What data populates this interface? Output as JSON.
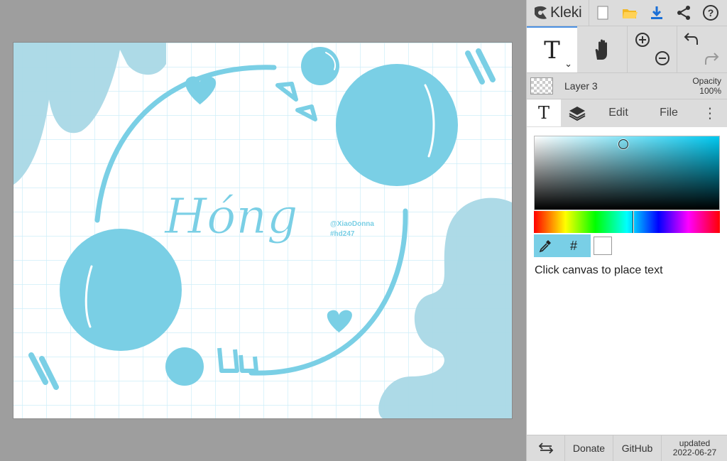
{
  "app": {
    "name": "Kleki"
  },
  "colors": {
    "accent": "#4a90e2",
    "art_blue": "#7acfe5",
    "art_blue_light": "#a9d8e6",
    "grid": "#cdeef9",
    "selected_color": "#00c8f0"
  },
  "canvas": {
    "art_title": "Hóng",
    "handle": "@XiaoDonna",
    "tag": "#hd247"
  },
  "toolbar": {
    "icons": [
      "new-file-icon",
      "open-folder-icon",
      "download-icon",
      "share-icon",
      "help-icon"
    ],
    "help_glyph": "?"
  },
  "tools": {
    "text_tool_glyph": "T",
    "dropdown_glyph": "⌄"
  },
  "layer": {
    "name": "Layer 3",
    "opacity_label": "Opacity",
    "opacity_value": "100%"
  },
  "tabs": {
    "text_glyph": "T",
    "edit": "Edit",
    "file": "File",
    "more": "⋮"
  },
  "color_panel": {
    "hex_label": "#",
    "hue_fraction": 0.53,
    "hint": "Click canvas to place text"
  },
  "footer": {
    "donate": "Donate",
    "github": "GitHub",
    "updated_label": "updated",
    "updated_date": "2022-06-27"
  }
}
